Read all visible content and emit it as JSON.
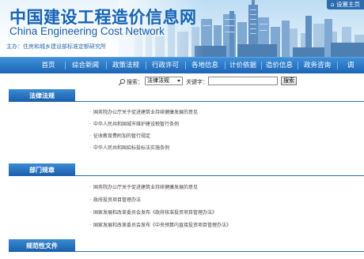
{
  "header": {
    "title_cn": "中国建设工程造价信息网",
    "title_en": "China Engineering Cost Network",
    "sponsor": "主办：住房和城乡建设部标准定额研究所",
    "set_home": "设置主页"
  },
  "nav": {
    "items": [
      {
        "label": "首页"
      },
      {
        "label": "综合新闻"
      },
      {
        "label": "政策法规"
      },
      {
        "label": "行政许可"
      },
      {
        "label": "各地信息"
      },
      {
        "label": "计价依据"
      },
      {
        "label": "造价信息"
      },
      {
        "label": "政务咨询"
      },
      {
        "label": "调"
      }
    ]
  },
  "search": {
    "label": "搜索：",
    "select_value": "法律法规",
    "keyword_label": "关键字：",
    "keyword_value": "",
    "button_label": "搜索"
  },
  "sections": [
    {
      "title": "法律法规",
      "items": [
        {
          "text": "国务院办公厅关于促进建筑业持续健康发展的意见"
        },
        {
          "text": "中华人民共和国城市维护建设税暂行条例"
        },
        {
          "text": "征收教育费附加的暂行规定"
        },
        {
          "text": "中华人民共和国招标投标法实施条例"
        }
      ]
    },
    {
      "title": "部门规章",
      "items": [
        {
          "text": "国务院办公厅关于促进建筑业持续健康发展的意见"
        },
        {
          "text": "政府投资项目管理办法"
        },
        {
          "text": "国家发展和改革委员会发布《政府核准投资项目管理办法》"
        },
        {
          "text": "国家发展和改革委员会发布《中央预算内直接投资项目管理办法》"
        }
      ]
    },
    {
      "title": "规范性文件",
      "items": []
    }
  ],
  "colors": {
    "brand_blue": "#1663b4",
    "nav_top": "#3f90d8",
    "nav_bottom": "#1c65b7"
  }
}
